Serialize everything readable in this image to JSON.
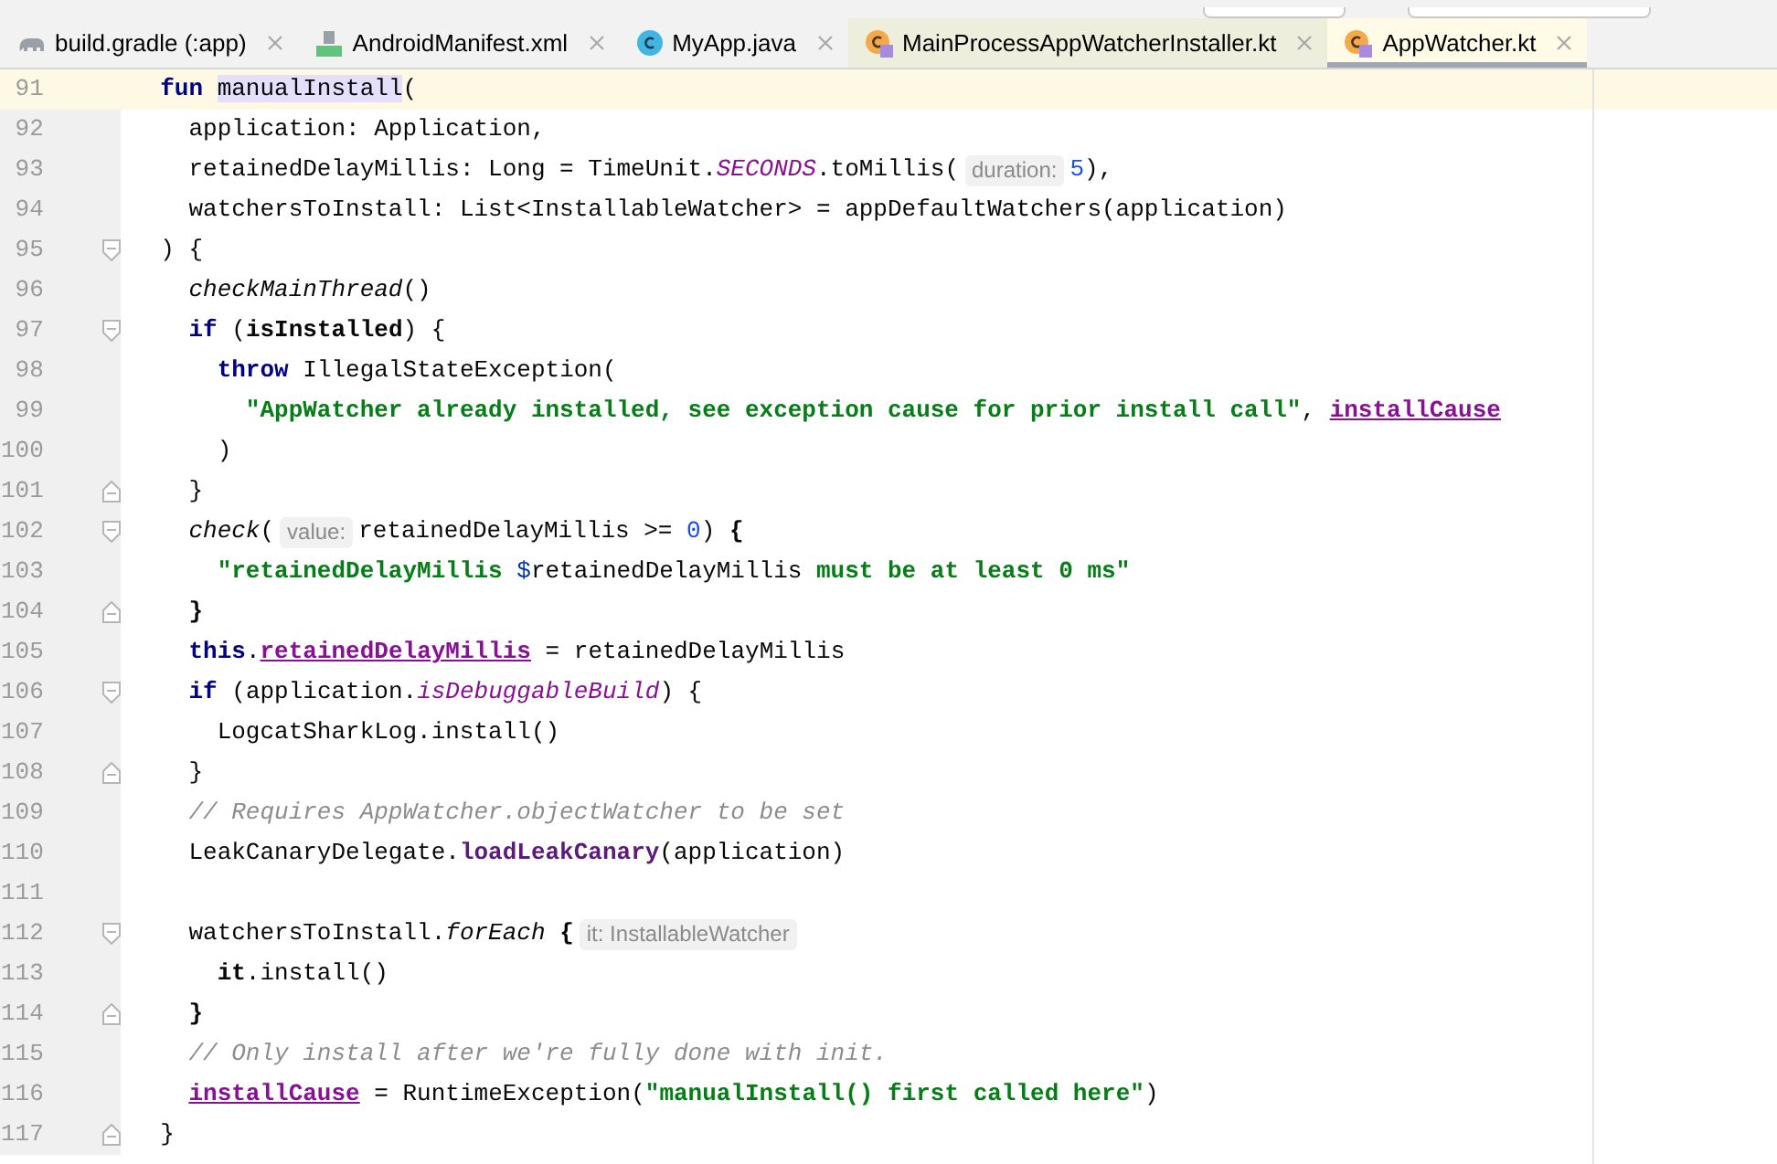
{
  "tabs": [
    {
      "label": "build.gradle (:app)",
      "kind": "gradle",
      "selected": false,
      "color": "#f2f2f2"
    },
    {
      "label": "AndroidManifest.xml",
      "kind": "manifest",
      "selected": false,
      "color": "#f2f2f2"
    },
    {
      "label": "MyApp.java",
      "kind": "java",
      "selected": false,
      "color": "#f2f2f2"
    },
    {
      "label": "MainProcessAppWatcherInstaller.kt",
      "kind": "kotlin",
      "selected": false,
      "color": "#eeeedd"
    },
    {
      "label": "AppWatcher.kt",
      "kind": "kotlin",
      "selected": true,
      "color": "#fffbe6"
    }
  ],
  "editor": {
    "lines": [
      {
        "number": "91",
        "current": true,
        "segments": [
          {
            "kind": "code",
            "tokens": [
              {
                "t": "  fun ",
                "kind": "keyword"
              },
              {
                "t": "manualInstall",
                "kind": "highlight"
              },
              {
                "t": "("
              }
            ]
          }
        ]
      },
      {
        "number": "92",
        "current": false,
        "segments": [
          {
            "kind": "code",
            "tokens": [
              {
                "t": "    application: Application,"
              }
            ]
          }
        ]
      },
      {
        "number": "93",
        "current": false,
        "segments": [
          {
            "kind": "code",
            "tokens": [
              {
                "t": "    retainedDelayMillis: Long = TimeUnit."
              },
              {
                "t": "SECONDS",
                "kind": "static"
              },
              {
                "t": ".toMillis("
              }
            ]
          },
          {
            "kind": "hint",
            "text": "duration:"
          },
          {
            "kind": "code",
            "tokens": [
              {
                "t": "5",
                "kind": "number"
              },
              {
                "t": "),"
              }
            ]
          }
        ]
      },
      {
        "number": "94",
        "current": false,
        "segments": [
          {
            "kind": "code",
            "tokens": [
              {
                "t": "    watchersToInstall: List<InstallableWatcher> = appDefaultWatchers(application)"
              }
            ]
          }
        ]
      },
      {
        "number": "95",
        "current": false,
        "fold_start": true,
        "segments": [
          {
            "kind": "code",
            "tokens": [
              {
                "t": "  ) {"
              }
            ]
          }
        ]
      },
      {
        "number": "96",
        "current": false,
        "segments": [
          {
            "kind": "code",
            "tokens": [
              {
                "t": "    checkMainThread",
                "kind": "call"
              },
              {
                "t": "()"
              }
            ]
          }
        ]
      },
      {
        "number": "97",
        "current": false,
        "fold_start": true,
        "segments": [
          {
            "kind": "code",
            "tokens": [
              {
                "t": "    if",
                "kind": "keyword"
              },
              {
                "t": " ("
              },
              {
                "t": "isInstalled",
                "kind": "bold"
              },
              {
                "t": ") {"
              }
            ]
          }
        ]
      },
      {
        "number": "98",
        "current": false,
        "segments": [
          {
            "kind": "code",
            "tokens": [
              {
                "t": "      throw",
                "kind": "keyword"
              },
              {
                "t": " IllegalStateException("
              }
            ]
          }
        ]
      },
      {
        "number": "99",
        "current": false,
        "segments": [
          {
            "kind": "code",
            "tokens": [
              {
                "t": "        \"AppWatcher already installed, see exception cause for prior install call\"",
                "kind": "string"
              },
              {
                "t": ", "
              },
              {
                "t": "installCause",
                "kind": "field"
              }
            ]
          }
        ]
      },
      {
        "number": "100",
        "current": false,
        "segments": [
          {
            "kind": "code",
            "tokens": [
              {
                "t": "      )"
              }
            ]
          }
        ]
      },
      {
        "number": "101",
        "current": false,
        "fold_end": true,
        "segments": [
          {
            "kind": "code",
            "tokens": [
              {
                "t": "    }"
              }
            ]
          }
        ]
      },
      {
        "number": "102",
        "current": false,
        "fold_start": true,
        "segments": [
          {
            "kind": "code",
            "tokens": [
              {
                "t": "    check",
                "kind": "call"
              },
              {
                "t": "("
              }
            ]
          },
          {
            "kind": "hint",
            "text": "value:"
          },
          {
            "kind": "code",
            "tokens": [
              {
                "t": "retainedDelayMillis >= "
              },
              {
                "t": "0",
                "kind": "number"
              },
              {
                "t": ") "
              },
              {
                "t": "{",
                "kind": "bold"
              }
            ]
          }
        ]
      },
      {
        "number": "103",
        "current": false,
        "segments": [
          {
            "kind": "code",
            "tokens": [
              {
                "t": "      \"retainedDelayMillis ",
                "kind": "string"
              },
              {
                "t": "$",
                "kind": "template"
              },
              {
                "t": "retainedDelayMillis"
              },
              {
                "t": " must be at least 0 ms\"",
                "kind": "string"
              }
            ]
          }
        ]
      },
      {
        "number": "104",
        "current": false,
        "fold_end": true,
        "segments": [
          {
            "kind": "code",
            "tokens": [
              {
                "t": "    }",
                "kind": "bold"
              }
            ]
          }
        ]
      },
      {
        "number": "105",
        "current": false,
        "segments": [
          {
            "kind": "code",
            "tokens": [
              {
                "t": "    this",
                "kind": "keyword"
              },
              {
                "t": "."
              },
              {
                "t": "retainedDelayMillis",
                "kind": "field"
              },
              {
                "t": " = retainedDelayMillis"
              }
            ]
          }
        ]
      },
      {
        "number": "106",
        "current": false,
        "fold_start": true,
        "segments": [
          {
            "kind": "code",
            "tokens": [
              {
                "t": "    if",
                "kind": "keyword"
              },
              {
                "t": " (application."
              },
              {
                "t": "isDebuggableBuild",
                "kind": "static"
              },
              {
                "t": ") {"
              }
            ]
          }
        ]
      },
      {
        "number": "107",
        "current": false,
        "segments": [
          {
            "kind": "code",
            "tokens": [
              {
                "t": "      LogcatSharkLog.install()"
              }
            ]
          }
        ]
      },
      {
        "number": "108",
        "current": false,
        "fold_end": true,
        "segments": [
          {
            "kind": "code",
            "tokens": [
              {
                "t": "    }"
              }
            ]
          }
        ]
      },
      {
        "number": "109",
        "current": false,
        "segments": [
          {
            "kind": "code",
            "tokens": [
              {
                "t": "    // Requires AppWatcher.objectWatcher to be set",
                "kind": "comment"
              }
            ]
          }
        ]
      },
      {
        "number": "110",
        "current": false,
        "segments": [
          {
            "kind": "code",
            "tokens": [
              {
                "t": "    LeakCanaryDelegate."
              },
              {
                "t": "loadLeakCanary",
                "kind": "member"
              },
              {
                "t": "(application)"
              }
            ]
          }
        ]
      },
      {
        "number": "111",
        "current": false
      },
      {
        "number": "112",
        "current": false,
        "fold_start": true,
        "segments": [
          {
            "kind": "code",
            "tokens": [
              {
                "t": "    watchersToInstall."
              },
              {
                "t": "forEach",
                "kind": "call"
              },
              {
                "t": " {",
                "kind": "bold"
              }
            ]
          },
          {
            "kind": "hint",
            "text": "it: InstallableWatcher"
          }
        ]
      },
      {
        "number": "113",
        "current": false,
        "segments": [
          {
            "kind": "code",
            "tokens": [
              {
                "t": "      it",
                "kind": "bold"
              },
              {
                "t": ".install()"
              }
            ]
          }
        ]
      },
      {
        "number": "114",
        "current": false,
        "fold_end": true,
        "segments": [
          {
            "kind": "code",
            "tokens": [
              {
                "t": "    }",
                "kind": "bold"
              }
            ]
          }
        ]
      },
      {
        "number": "115",
        "current": false,
        "segments": [
          {
            "kind": "code",
            "tokens": [
              {
                "t": "    // Only install after we're fully done with init.",
                "kind": "comment"
              }
            ]
          }
        ]
      },
      {
        "number": "116",
        "current": false,
        "segments": [
          {
            "kind": "code",
            "tokens": [
              {
                "t": "    installCause",
                "kind": "field"
              },
              {
                "t": " = RuntimeException("
              },
              {
                "t": "\"manualInstall() first called here\"",
                "kind": "string"
              },
              {
                "t": ")"
              }
            ]
          }
        ]
      },
      {
        "number": "117",
        "current": false,
        "fold_end": true,
        "segments": [
          {
            "kind": "code",
            "tokens": [
              {
                "t": "  }"
              }
            ]
          }
        ]
      }
    ]
  }
}
